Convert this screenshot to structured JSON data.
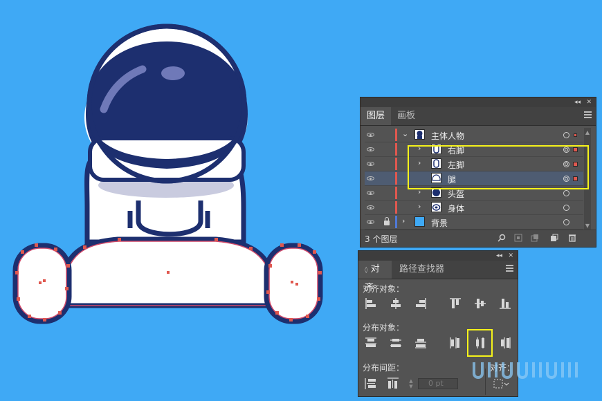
{
  "layers_panel": {
    "tabs": [
      "图层",
      "画板"
    ],
    "active_tab": 0,
    "rows": [
      {
        "name": "主体人物",
        "level": 0,
        "expanded": true,
        "bar": "#e0584f",
        "thumb": "astronaut"
      },
      {
        "name": "右脚",
        "level": 1,
        "expanded": false,
        "bar": "#e0584f",
        "thumb": "foot",
        "selected_art": true
      },
      {
        "name": "左脚",
        "level": 1,
        "expanded": false,
        "bar": "#e0584f",
        "thumb": "foot",
        "selected_art": true
      },
      {
        "name": "腿",
        "level": 1,
        "expanded": false,
        "bar": "#e0584f",
        "thumb": "leg",
        "selected_art": true,
        "highlighted": true
      },
      {
        "name": "头盔",
        "level": 1,
        "expanded": false,
        "bar": "#e0584f",
        "thumb": "helmet"
      },
      {
        "name": "身体",
        "level": 1,
        "expanded": false,
        "bar": "#e0584f",
        "thumb": "body"
      },
      {
        "name": "背景",
        "level": 0,
        "expanded": false,
        "bar": "#4f79d6",
        "thumb": "blue",
        "locked": true
      }
    ],
    "footer_text": "3 个图层"
  },
  "align_panel": {
    "tabs": [
      "对齐",
      "路径查找器"
    ],
    "sections": {
      "align_objects": "对齐对象：",
      "distribute_objects": "分布对象：",
      "distribute_spacing": "分布间距：",
      "align_to": "对齐："
    },
    "spacing_value": "0 pt"
  },
  "colors": {
    "background": "#3fa9f5",
    "navy": "#1d2f6f",
    "highlight_box": "#f6f31a",
    "selection_red": "#e0584f"
  },
  "icons": [
    "eye-icon",
    "lock-icon",
    "search-icon",
    "new-sublayer-icon",
    "new-layer-icon",
    "trash-icon",
    "menu-icon"
  ]
}
